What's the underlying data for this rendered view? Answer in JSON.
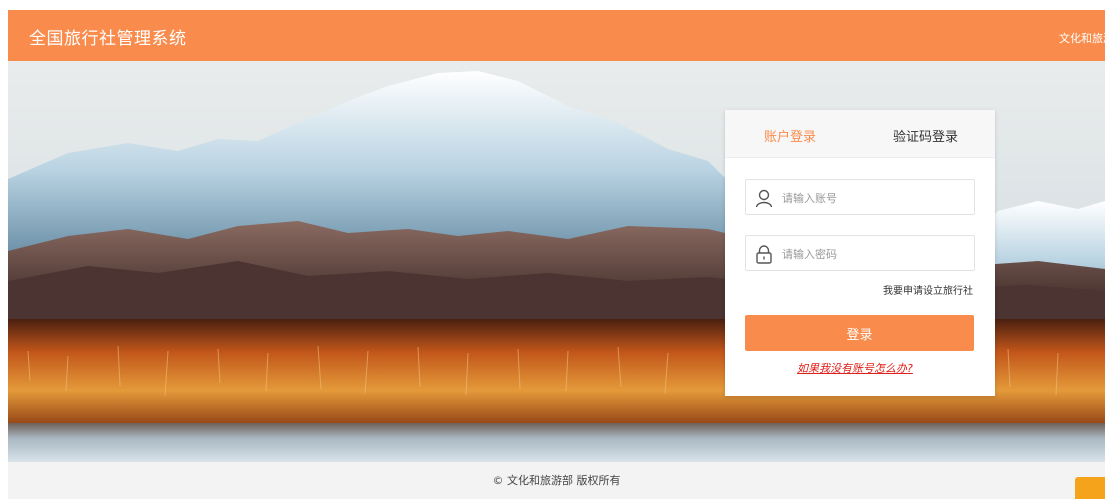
{
  "header": {
    "title": "全国旅行社管理系统",
    "right_link": "文化和旅游部"
  },
  "login": {
    "tab_account": "账户登录",
    "tab_code": "验证码登录",
    "username_placeholder": "请输入账号",
    "password_placeholder": "请输入密码",
    "apply_link": "我要申请设立旅行社",
    "login_button": "登录",
    "help_link": "如果我没有账号怎么办?"
  },
  "footer": {
    "copyright": "© 文化和旅游部 版权所有"
  },
  "colors": {
    "accent": "#f98c4c",
    "help_link": "#e0201a",
    "badge": "#f5a31a"
  },
  "icons": {
    "username": "user-icon",
    "password": "lock-icon"
  }
}
